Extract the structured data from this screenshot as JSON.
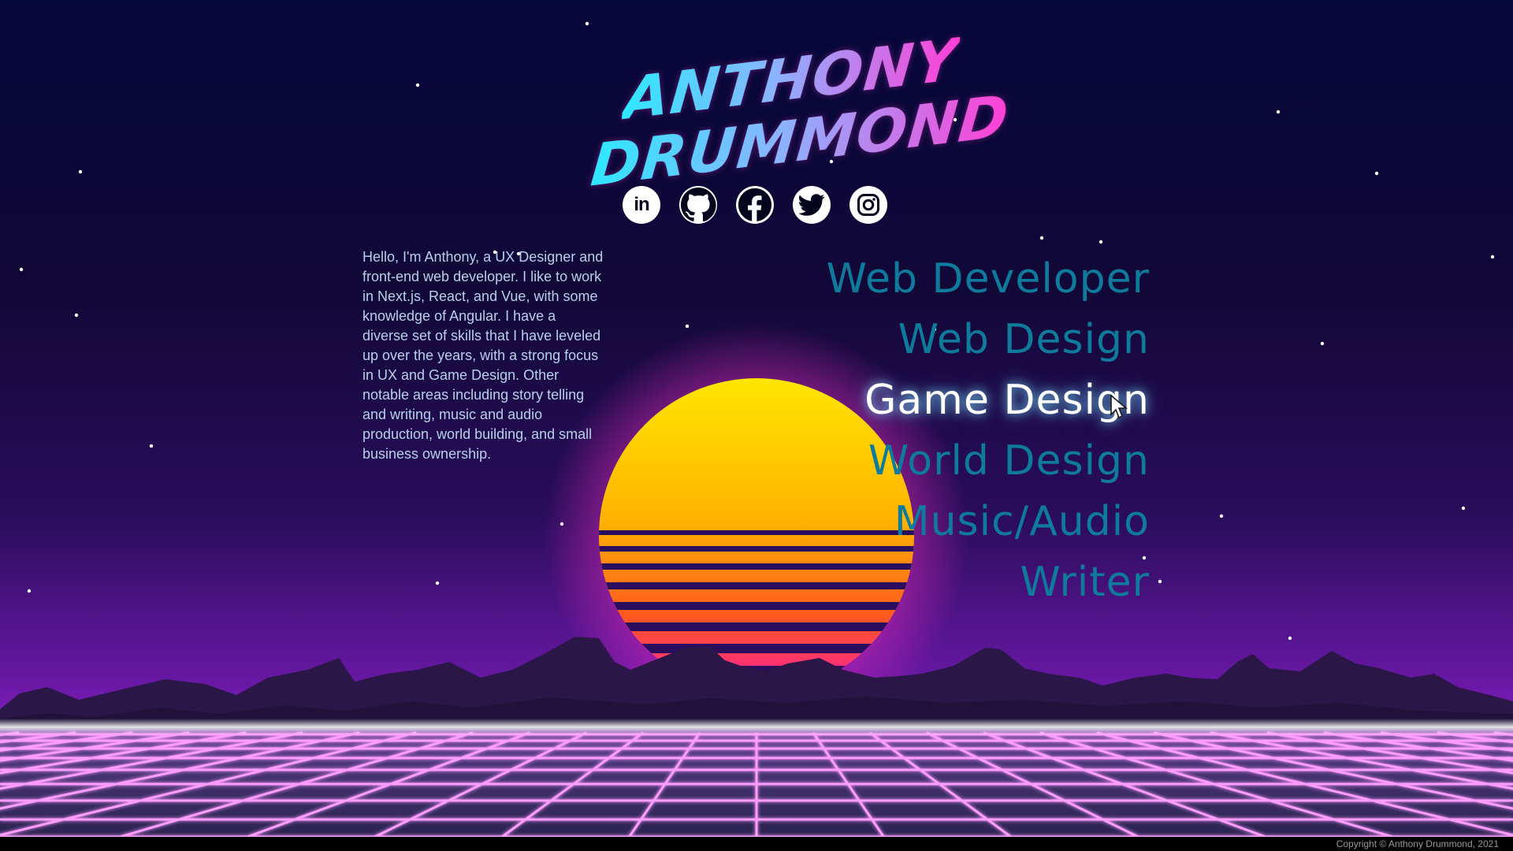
{
  "header": {
    "name_line1": "ANTHONY",
    "name_line2": "DRUMMOND"
  },
  "social": [
    {
      "name": "LinkedIn",
      "label": "in",
      "icon": "linkedin-icon"
    },
    {
      "name": "GitHub",
      "icon": "github-icon"
    },
    {
      "name": "Facebook",
      "icon": "facebook-icon"
    },
    {
      "name": "Twitter",
      "icon": "twitter-icon"
    },
    {
      "name": "Instagram",
      "icon": "instagram-icon"
    }
  ],
  "about": {
    "text": "Hello, I'm Anthony, a UX Designer and front-end web developer. I like to work in Next.js, React, and Vue, with some knowledge of Angular. I have a diverse set of skills that I have leveled up over the years, with a strong focus in UX and Game Design. Other notable areas including story telling and writing, music and audio production, world building, and small business ownership."
  },
  "skills": {
    "items": [
      "Web Developer",
      "Web Design",
      "Game Design",
      "World Design",
      "Music/Audio",
      "Writer"
    ],
    "active": "Game Design"
  },
  "footer": {
    "copyright": "Copyright © Anthony Drummond, 2021"
  },
  "colors": {
    "sky_top": "#05063a",
    "sky_bottom": "#8a1fc8",
    "sun_top": "#ffe600",
    "sun_bottom": "#ff1aa0",
    "grid_line": "#ff8cff",
    "skill_text": "#0f7b9c",
    "skill_active": "#ffffff",
    "about_text": "#b7d0ea"
  }
}
